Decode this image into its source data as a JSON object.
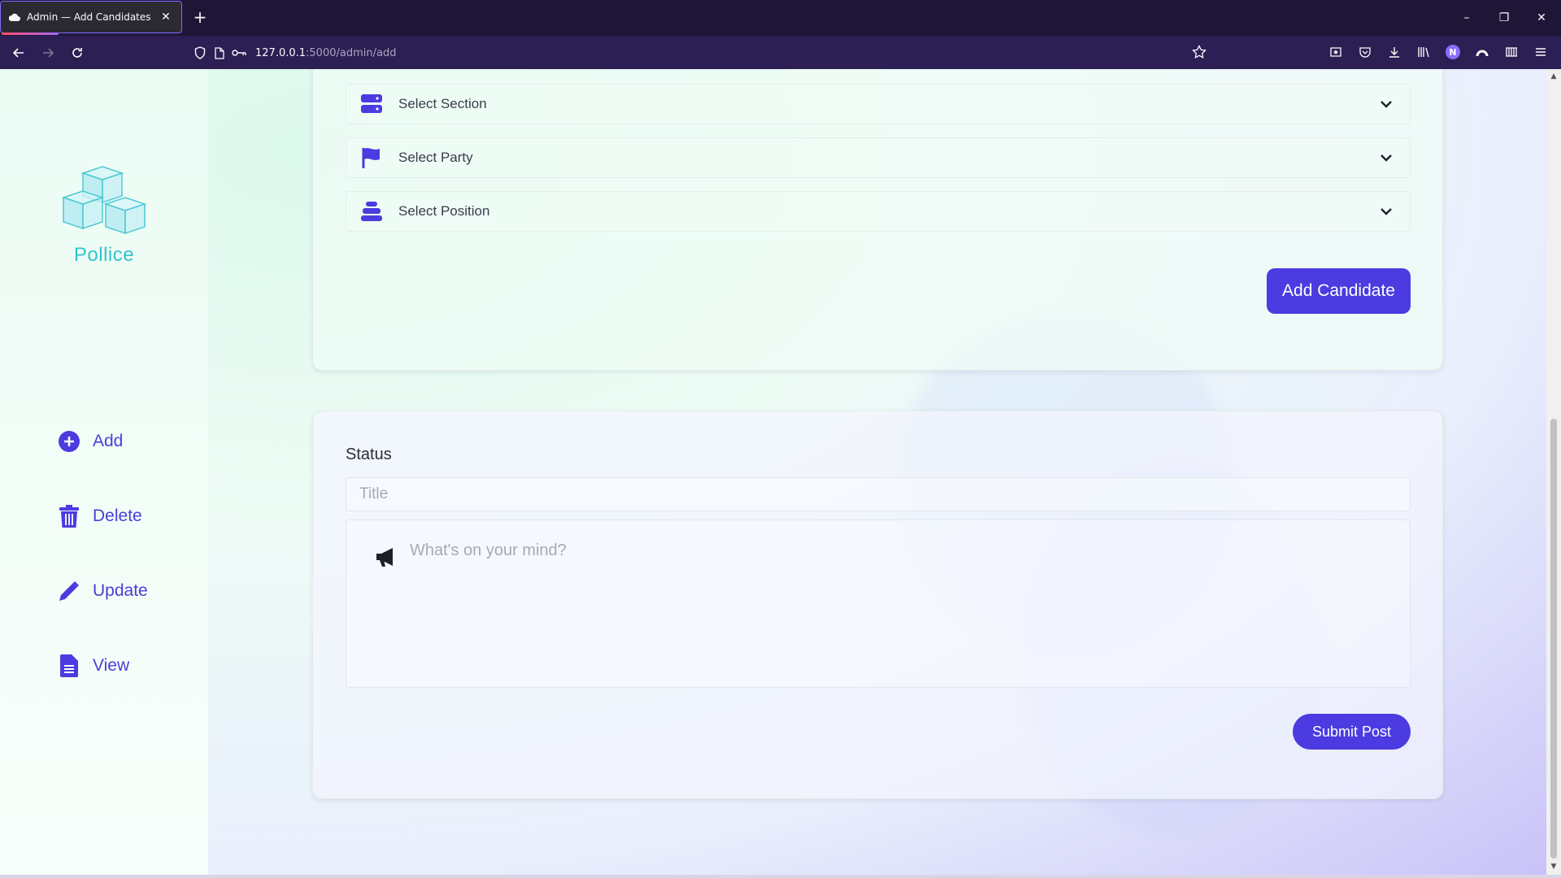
{
  "browser": {
    "tab_title": "Admin — Add Candidates",
    "new_tab_symbol": "+",
    "url_host": "127.0.0.1",
    "url_path": ":5000/admin/add",
    "profile_initial": "N",
    "window_controls": {
      "minimize": "–",
      "restore": "❐",
      "close": "✕"
    }
  },
  "sidebar": {
    "brand": "Pollice",
    "items": [
      {
        "label": "Add",
        "icon": "plus-circle-icon"
      },
      {
        "label": "Delete",
        "icon": "trash-icon"
      },
      {
        "label": "Update",
        "icon": "pencil-icon"
      },
      {
        "label": "View",
        "icon": "file-icon"
      }
    ]
  },
  "candidate_form": {
    "section_select": "Select Section",
    "party_select": "Select Party",
    "position_select": "Select Position",
    "submit_label": "Add Candidate"
  },
  "status_form": {
    "heading": "Status",
    "title_placeholder": "Title",
    "post_placeholder": "What's on your mind?",
    "submit_label": "Submit Post"
  },
  "colors": {
    "accent": "#4b3be0",
    "brand": "#2fc4cf"
  }
}
